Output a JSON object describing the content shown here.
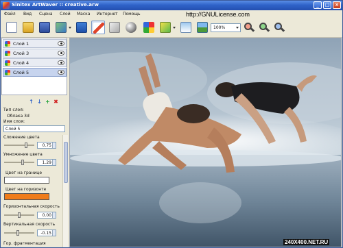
{
  "window": {
    "title": "Sinitex ArtWaver :: creative.arw",
    "buttons": [
      "_",
      "□",
      "×"
    ]
  },
  "menu": {
    "items": [
      "Файл",
      "Вид",
      "Сцена",
      "Слой",
      "Маска",
      "Интернет",
      "Помощь"
    ],
    "overlay_url": "http://GNULicense.com"
  },
  "toolbar": {
    "zoom": "100%",
    "buttons": [
      "new-document-icon",
      "open-folder-icon",
      "save-icon",
      "layers-stack-icon",
      "image-icon",
      "brush-icon",
      "eraser-icon",
      "sphere-icon",
      "color-palette-icon",
      "gradient-icon",
      "mask-icon",
      "landscape-icon",
      "zoom-out-icon",
      "zoom-in-icon",
      "zoom-fit-icon"
    ]
  },
  "layers": [
    {
      "label": "Слой 1",
      "selected": false
    },
    {
      "label": "Слой 3",
      "selected": false
    },
    {
      "label": "Слой 4",
      "selected": false
    },
    {
      "label": "Слой 5",
      "selected": true
    }
  ],
  "layer_actions": [
    "↑",
    "↓",
    "+",
    "✖"
  ],
  "properties": {
    "layer_type_label": "Тип слоя:",
    "layer_type_value": "Облака 3d",
    "layer_name_label": "Имя слоя:",
    "layer_name_value": "Слой 5",
    "color_add_label": "Сложение цвета",
    "color_add_value": "0.75",
    "color_add_level": 0.75,
    "color_mul_label": "Умножение цвета",
    "color_mul_value": "1.29",
    "color_mul_level": 0.62,
    "border_color_label": "Цвет на границе",
    "border_color": "#ffffff",
    "horizon_color_label": "Цвет на горизонте",
    "horizon_color": "#f07c1a",
    "h_speed_label": "Горизонтальная скорость",
    "h_speed_value": "0.00",
    "h_speed_level": 0.5,
    "v_speed_label": "Вертикальная скорость",
    "v_speed_value": "-0.15",
    "v_speed_level": 0.45,
    "fragmentation_label": "Гор. фрагментация"
  },
  "watermark": "240X400.NET.RU",
  "colors": {
    "titlebar": "#2f63c9",
    "selected_layer": "#c7d4ee",
    "horizon": "#f07c1a"
  }
}
